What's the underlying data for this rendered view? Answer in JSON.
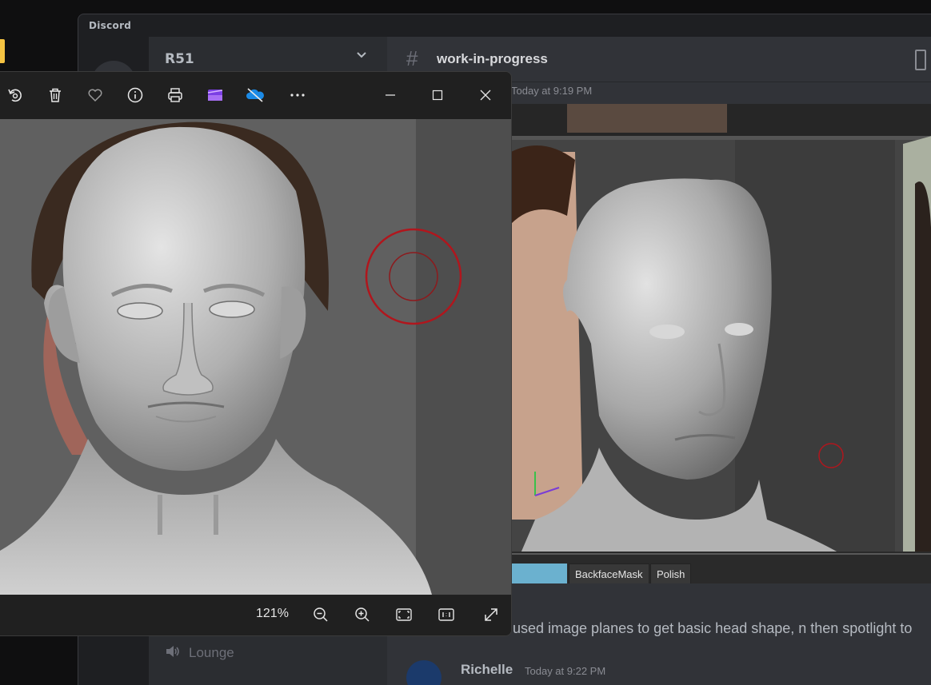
{
  "discord": {
    "app_title": "Discord",
    "server_name": "R51",
    "channel_name": "work-in-progress",
    "message_timestamp": "Today at 9:19 PM",
    "message_text": "used image planes to get basic head shape, n then spotlight to",
    "voice_channel": "Lounge",
    "next_author": "Richelle",
    "next_timestamp": "Today at 9:22 PM",
    "attachment_tabs": [
      "BackfaceMask",
      "Polish"
    ]
  },
  "viewer": {
    "toolbar_icons": [
      "rotate-icon",
      "delete-icon",
      "favorite-icon",
      "info-icon",
      "print-icon",
      "clipchamp-icon",
      "onedrive-icon",
      "more-icon",
      "minimize-icon",
      "maximize-icon",
      "close-icon"
    ],
    "zoom_level": "121%",
    "footer_icons": [
      "zoom-out-icon",
      "zoom-in-icon",
      "fit-to-window-icon",
      "actual-size-icon",
      "fullscreen-icon"
    ]
  },
  "colors": {
    "discord_bg": "#313338",
    "viewer_bg": "#202020",
    "sculpt_gray": "#bdbdbd",
    "brush_red": "#c0141b"
  }
}
